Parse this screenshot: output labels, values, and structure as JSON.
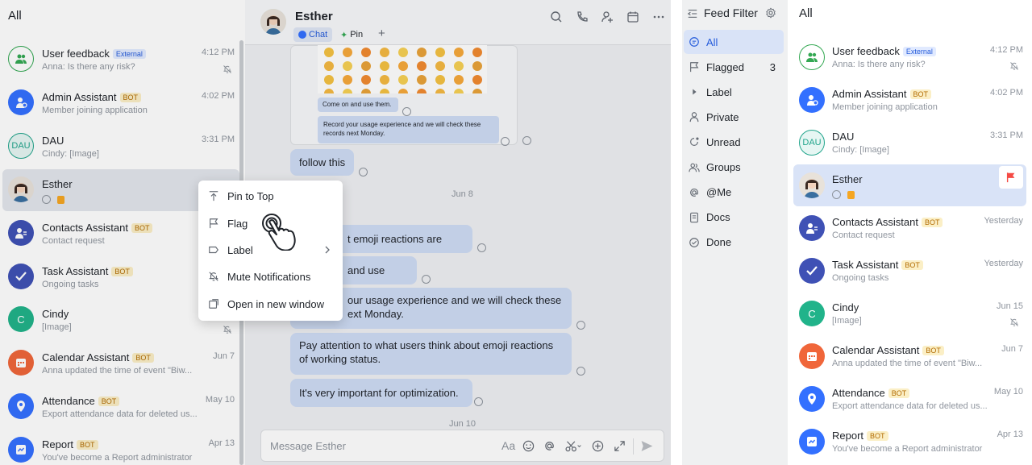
{
  "left_panel": {
    "feed_title": "All",
    "items": [
      {
        "name": "User feedback",
        "tag": "External",
        "subtitle": "Anna: Is there any risk?",
        "time": "4:12 PM",
        "muted": true
      },
      {
        "name": "Admin Assistant",
        "tag": "BOT",
        "subtitle": "Member joining application",
        "time": "4:02 PM"
      },
      {
        "name": "DAU",
        "tag": "",
        "subtitle": "Cindy: [Image]",
        "time": "3:31 PM",
        "avatar_text": "DAU"
      },
      {
        "name": "Esther",
        "tag": "",
        "subtitle": "",
        "time": ""
      },
      {
        "name": "Contacts Assistant",
        "tag": "BOT",
        "subtitle": "Contact request",
        "time": "Y"
      },
      {
        "name": "Task Assistant",
        "tag": "BOT",
        "subtitle": "Ongoing tasks",
        "time": "Y"
      },
      {
        "name": "Cindy",
        "tag": "",
        "subtitle": "[Image]",
        "time": "",
        "avatar_text": "C",
        "muted": true
      },
      {
        "name": "Calendar Assistant",
        "tag": "BOT",
        "subtitle": "Anna updated the time of event \"Biw...",
        "time": "Jun 7"
      },
      {
        "name": "Attendance",
        "tag": "BOT",
        "subtitle": "Export attendance data for deleted us...",
        "time": "May 10"
      },
      {
        "name": "Report",
        "tag": "BOT",
        "subtitle": "You've become a Report administrator",
        "time": "Apr 13"
      }
    ],
    "chat": {
      "contact_name": "Esther",
      "tab_chat": "Chat",
      "tab_pin": "Pin",
      "tab_add": "+",
      "quoted_1": "Come on and use them.",
      "quoted_2": "Record your usage experience and we will check these records next Monday.",
      "msg_follow": "follow this",
      "date_1": "Jun 8",
      "msg_1": "t emoji reactions are done.",
      "msg_2": "and use them.",
      "msg_3_line1": "our usage experience and we will check these",
      "msg_3_line2": "ext Monday.",
      "msg_4": "Pay attention to what users think about emoji reactions of working status.",
      "msg_5": "It's very important for optimization.",
      "date_2": "Jun 10",
      "input_placeholder": "Message Esther",
      "aa_label": "Aa"
    },
    "context_menu": {
      "items": [
        {
          "label": "Pin to Top",
          "icon": "pin-top-icon"
        },
        {
          "label": "Flag",
          "icon": "flag-icon"
        },
        {
          "label": "Label",
          "icon": "label-icon"
        },
        {
          "label": "Mute Notifications",
          "icon": "bell-off-icon"
        },
        {
          "label": "Open in new window",
          "icon": "new-window-icon"
        }
      ]
    }
  },
  "right_panel": {
    "filter_title": "Feed Filter",
    "filters": [
      {
        "label": "All",
        "icon": "chat-bubble-icon",
        "count": ""
      },
      {
        "label": "Flagged",
        "icon": "flag-icon",
        "count": "3"
      },
      {
        "label": "Label",
        "icon": "caret-right-icon",
        "count": ""
      },
      {
        "label": "Private",
        "icon": "person-icon",
        "count": ""
      },
      {
        "label": "Unread",
        "icon": "unread-icon",
        "count": ""
      },
      {
        "label": "Groups",
        "icon": "groups-icon",
        "count": ""
      },
      {
        "label": "@Me",
        "icon": "at-icon",
        "count": ""
      },
      {
        "label": "Docs",
        "icon": "docs-icon",
        "count": ""
      },
      {
        "label": "Done",
        "icon": "check-circle-icon",
        "count": ""
      }
    ],
    "feed_title": "All",
    "items": [
      {
        "name": "User feedback",
        "tag": "External",
        "subtitle": "Anna: Is there any risk?",
        "time": "4:12 PM",
        "muted": true
      },
      {
        "name": "Admin Assistant",
        "tag": "BOT",
        "subtitle": "Member joining application",
        "time": "4:02 PM"
      },
      {
        "name": "DAU",
        "tag": "",
        "subtitle": "Cindy: [Image]",
        "time": "3:31 PM",
        "avatar_text": "DAU"
      },
      {
        "name": "Esther",
        "tag": "",
        "subtitle": "",
        "time": "",
        "flagged": true
      },
      {
        "name": "Contacts Assistant",
        "tag": "BOT",
        "subtitle": "Contact request",
        "time": "Yesterday"
      },
      {
        "name": "Task Assistant",
        "tag": "BOT",
        "subtitle": "Ongoing tasks",
        "time": "Yesterday"
      },
      {
        "name": "Cindy",
        "tag": "",
        "subtitle": "[Image]",
        "time": "Jun 15",
        "avatar_text": "C",
        "muted": true
      },
      {
        "name": "Calendar Assistant",
        "tag": "BOT",
        "subtitle": "Anna updated the time of event \"Biw...",
        "time": "Jun 7"
      },
      {
        "name": "Attendance",
        "tag": "BOT",
        "subtitle": "Export attendance data for deleted us...",
        "time": "May 10"
      },
      {
        "name": "Report",
        "tag": "BOT",
        "subtitle": "You've become a Report administrator",
        "time": "Apr 13"
      }
    ]
  },
  "colors": {
    "accent": "#245bdb",
    "bubble": "#cfdcf5",
    "flag": "#f54a45",
    "bot_tag_bg": "#fbefc6",
    "ext_tag_bg": "#e1eaff"
  }
}
